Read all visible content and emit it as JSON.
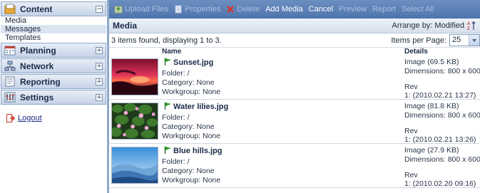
{
  "sidebar": {
    "content": {
      "title": "Content",
      "toggle": "−",
      "items": [
        "Media",
        "Messages",
        "Templates"
      ],
      "selected_index": 1
    },
    "planning": {
      "title": "Planning",
      "toggle": "+"
    },
    "network": {
      "title": "Network",
      "toggle": "+"
    },
    "reporting": {
      "title": "Reporting",
      "toggle": "+"
    },
    "settings": {
      "title": "Settings",
      "toggle": "+"
    },
    "logout": "Logout"
  },
  "toolbar": {
    "upload": "Upload Files",
    "properties": "Properties",
    "delete": "Delete",
    "add_media": "Add Media",
    "cancel": "Cancel",
    "preview": "Preview",
    "report": "Report",
    "select_all": "Select All"
  },
  "header": {
    "title": "Media",
    "arrange": "Arrange by: Modified"
  },
  "info": {
    "found": "3 items found, displaying 1 to 3.",
    "items_per_page_label": "Items per Page:",
    "items_per_page_value": "25"
  },
  "columns": {
    "name": "Name",
    "details": "Details"
  },
  "items": [
    {
      "name": "Sunset.jpg",
      "folder": "Folder: /",
      "category": "Category: None",
      "workgroup": "Workgroup: None",
      "image": "Image (69.5 KB)",
      "dimensions": "Dimensions: 800 x 600",
      "rev": "Rev",
      "rev_date": "1: (2010.02.21 13:27)",
      "thumb": "sunset"
    },
    {
      "name": "Water lilies.jpg",
      "folder": "Folder: /",
      "category": "Category: None",
      "workgroup": "Workgroup: None",
      "image": "Image (81.8 KB)",
      "dimensions": "Dimensions: 800 x 600",
      "rev": "Rev",
      "rev_date": "1: (2010.02.21 13:26)",
      "thumb": "lilies"
    },
    {
      "name": "Blue hills.jpg",
      "folder": "Folder: /",
      "category": "Category: None",
      "workgroup": "Workgroup: None",
      "image": "Image (27.9 KB)",
      "dimensions": "Dimensions: 800 x 600",
      "rev": "Rev",
      "rev_date": "1: (2010.02.20 09:16)",
      "thumb": "hills"
    }
  ],
  "colors": {
    "toolbar": "#5a80b7",
    "sidebar_border": "#8ea9c9",
    "flag": "#2a9a2a"
  }
}
